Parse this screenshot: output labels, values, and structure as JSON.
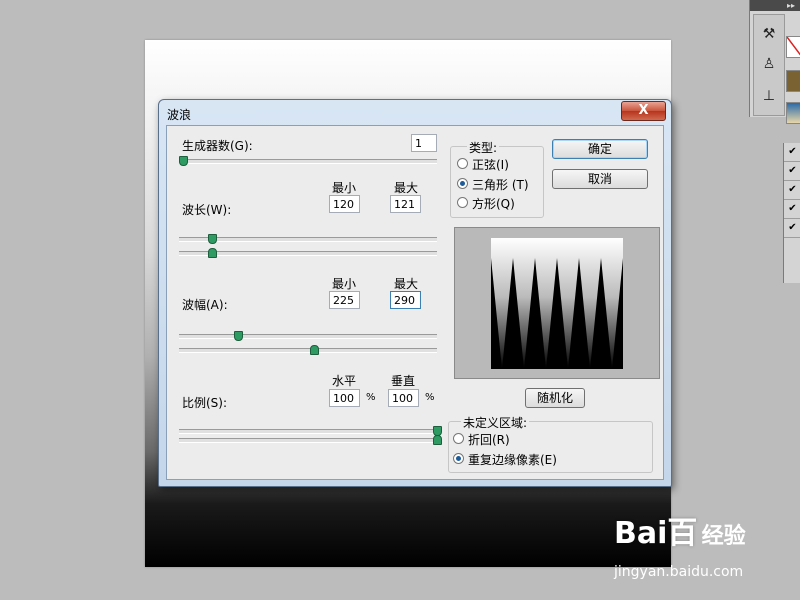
{
  "dialog": {
    "title": "波浪",
    "close_label": "X",
    "generators": {
      "label": "生成器数(G):",
      "value": "1",
      "slider_level": 0.0
    },
    "type": {
      "label": "类型:",
      "options": [
        {
          "label": "正弦(I)",
          "selected": false
        },
        {
          "label": "三角形 (T)",
          "selected": true
        },
        {
          "label": "方形(Q)",
          "selected": false
        }
      ]
    },
    "ok_label": "确定",
    "cancel_label": "取消",
    "wavelength": {
      "label": "波长(W):",
      "min_header": "最小",
      "max_header": "最大",
      "min": "120",
      "max": "121"
    },
    "amplitude": {
      "label": "波幅(A):",
      "min_header": "最小",
      "max_header": "最大",
      "min": "225",
      "max": "290"
    },
    "scale": {
      "label": "比例(S):",
      "h_header": "水平",
      "v_header": "垂直",
      "h": "100",
      "v": "100",
      "unit": "%"
    },
    "randomize_label": "随机化",
    "undefined_area": {
      "label": "未定义区域:",
      "options": [
        {
          "label": "折回(R)",
          "selected": false
        },
        {
          "label": "重复边缘像素(E)",
          "selected": true
        }
      ]
    }
  },
  "watermark": {
    "brand": "Bai",
    "brand2": "百",
    "jingyan": "经验",
    "url": "jingyan.baidu.com"
  },
  "colors": {
    "thumb": "#2e9b62",
    "dialog_frame": "#c4d6ea",
    "close": "#c9543c"
  }
}
